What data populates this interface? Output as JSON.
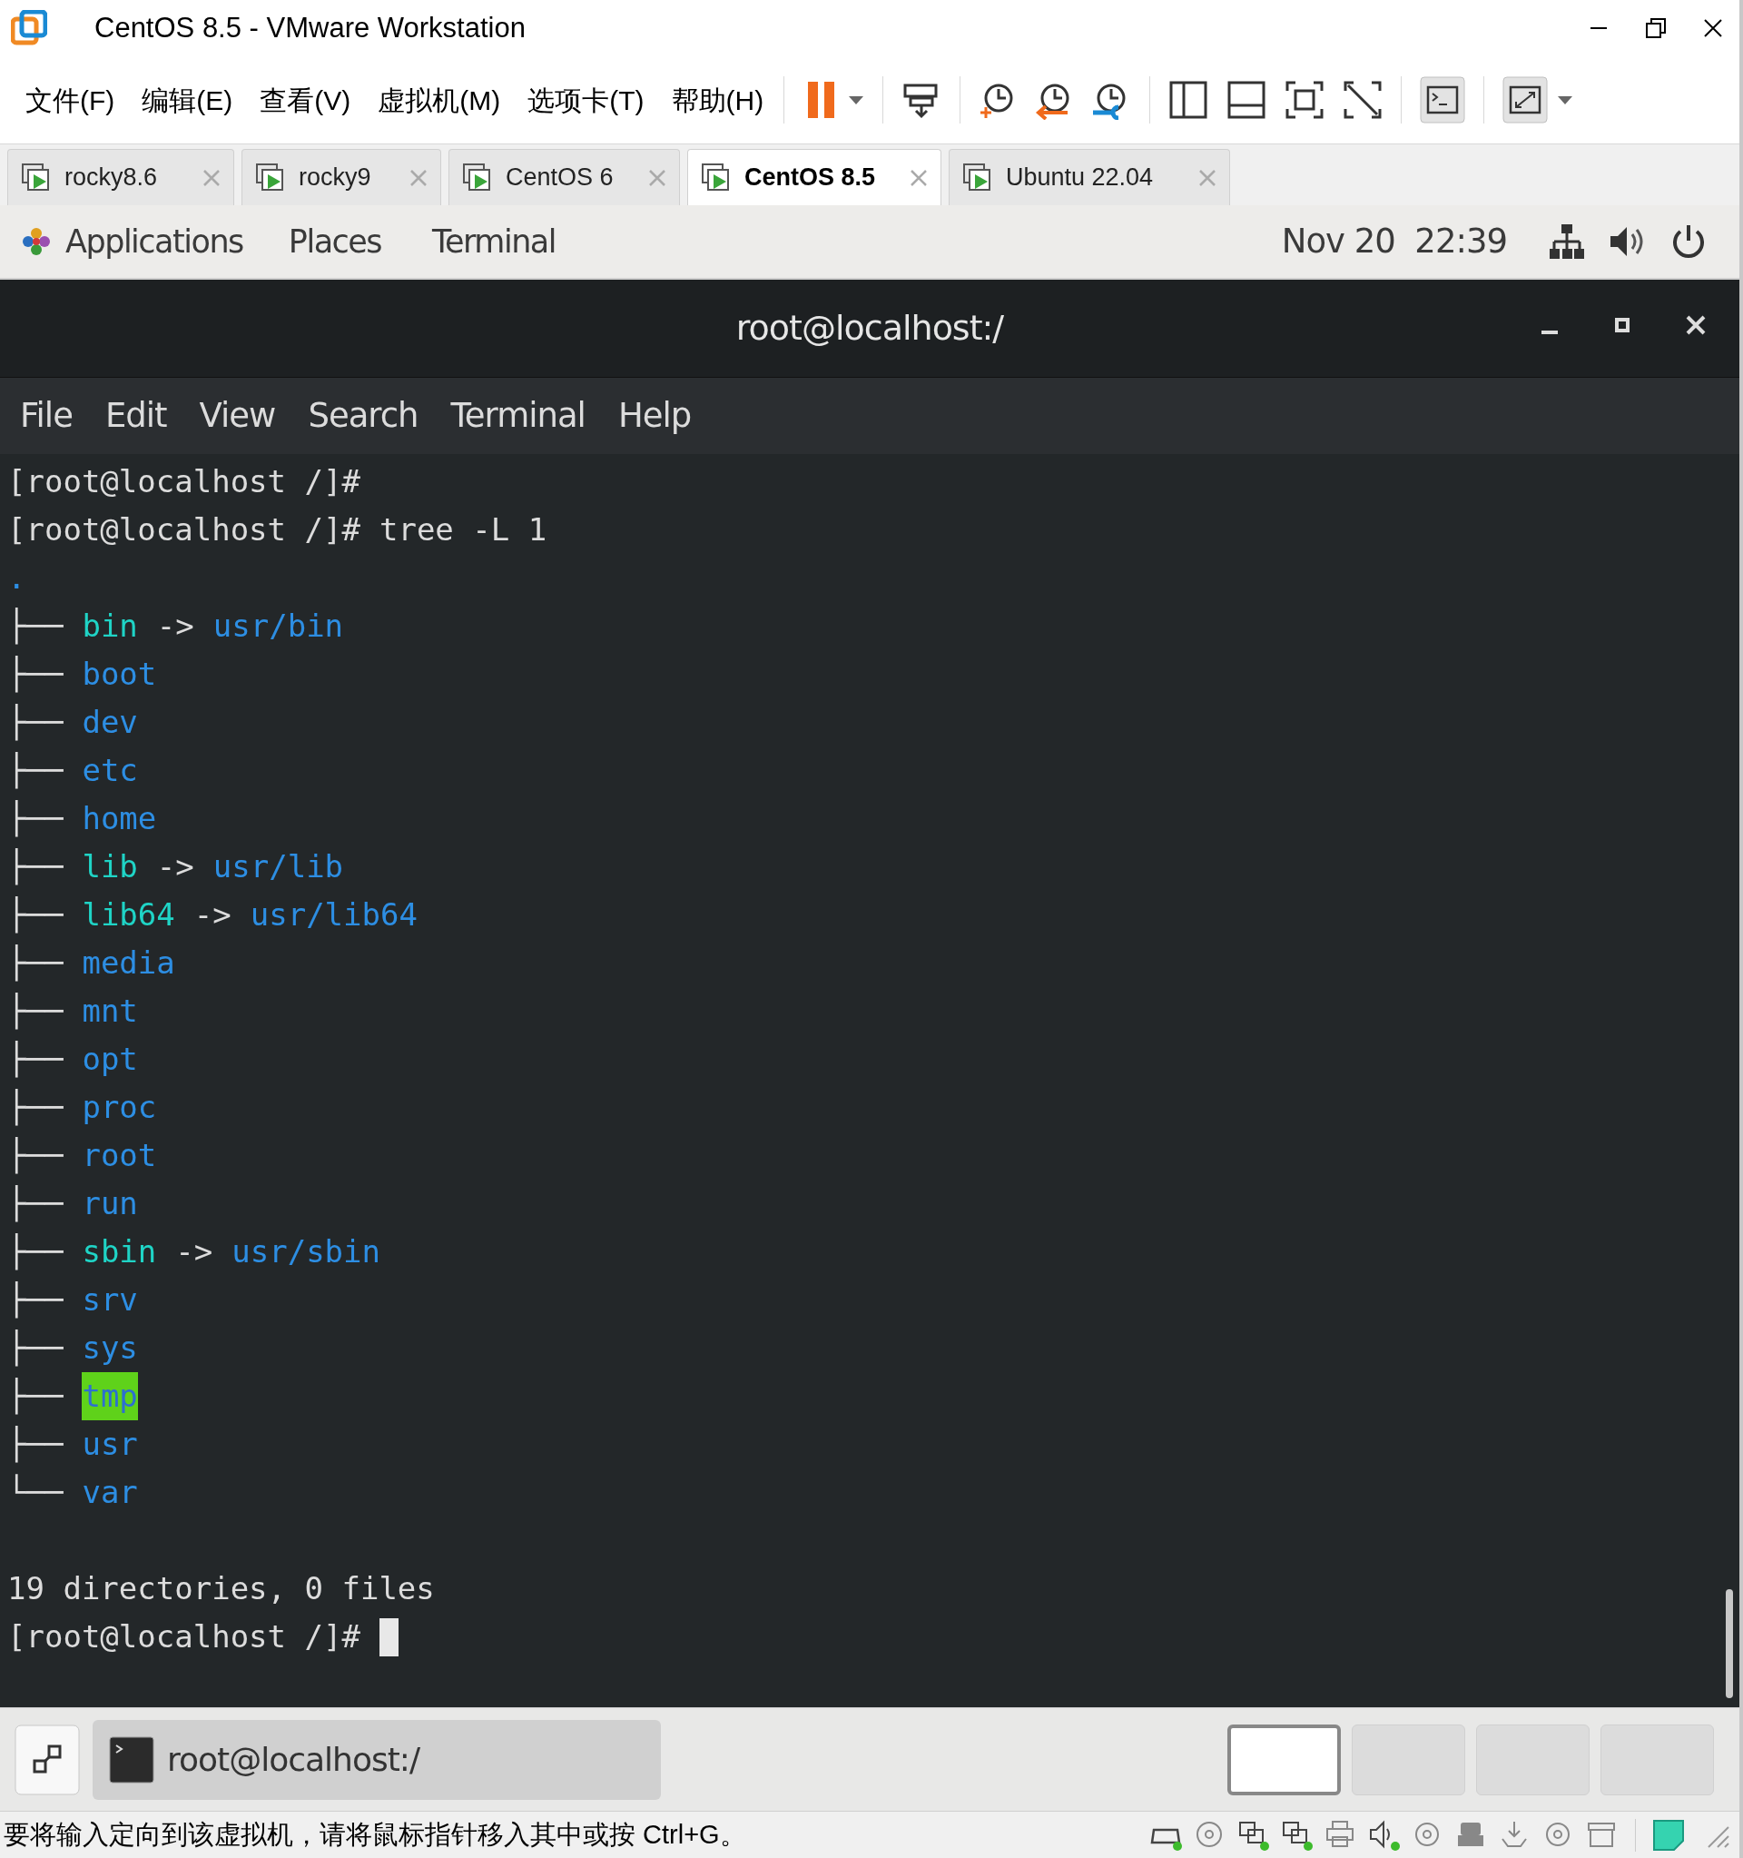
{
  "window": {
    "title": "CentOS 8.5 - VMware Workstation"
  },
  "menu": [
    "文件(F)",
    "编辑(E)",
    "查看(V)",
    "虚拟机(M)",
    "选项卡(T)",
    "帮助(H)"
  ],
  "tabs": [
    {
      "label": "rocky8.6",
      "selected": false
    },
    {
      "label": "rocky9",
      "selected": false
    },
    {
      "label": "CentOS 6",
      "selected": false
    },
    {
      "label": "CentOS 8.5",
      "selected": true
    },
    {
      "label": "Ubuntu 22.04",
      "selected": false
    }
  ],
  "gnome_bar": {
    "items": [
      "Applications",
      "Places",
      "Terminal"
    ],
    "clock": "Nov 20  22:39"
  },
  "terminal": {
    "title": "root@localhost:/",
    "menu": [
      "File",
      "Edit",
      "View",
      "Search",
      "Terminal",
      "Help"
    ],
    "lines": [
      {
        "kind": "prompt",
        "prompt": "[root@localhost /]#"
      },
      {
        "kind": "prompt",
        "prompt": "[root@localhost /]#",
        "command": "tree -L 1"
      },
      {
        "kind": "tree_root",
        "text": "."
      },
      {
        "kind": "link_entry",
        "branch": "├──",
        "name": "bin",
        "arrow": "->",
        "target": "usr/bin"
      },
      {
        "kind": "dir_entry",
        "branch": "├──",
        "name": "boot"
      },
      {
        "kind": "dir_entry",
        "branch": "├──",
        "name": "dev"
      },
      {
        "kind": "dir_entry",
        "branch": "├──",
        "name": "etc"
      },
      {
        "kind": "dir_entry",
        "branch": "├──",
        "name": "home"
      },
      {
        "kind": "link_entry",
        "branch": "├──",
        "name": "lib",
        "arrow": "->",
        "target": "usr/lib"
      },
      {
        "kind": "link_entry",
        "branch": "├──",
        "name": "lib64",
        "arrow": "->",
        "target": "usr/lib64"
      },
      {
        "kind": "dir_entry",
        "branch": "├──",
        "name": "media"
      },
      {
        "kind": "dir_entry",
        "branch": "├──",
        "name": "mnt"
      },
      {
        "kind": "dir_entry",
        "branch": "├──",
        "name": "opt"
      },
      {
        "kind": "dir_entry",
        "branch": "├──",
        "name": "proc"
      },
      {
        "kind": "dir_entry",
        "branch": "├──",
        "name": "root"
      },
      {
        "kind": "dir_entry",
        "branch": "├──",
        "name": "run"
      },
      {
        "kind": "link_entry",
        "branch": "├──",
        "name": "sbin",
        "arrow": "->",
        "target": "usr/sbin"
      },
      {
        "kind": "dir_entry",
        "branch": "├──",
        "name": "srv"
      },
      {
        "kind": "dir_entry",
        "branch": "├──",
        "name": "sys"
      },
      {
        "kind": "sticky_entry",
        "branch": "├──",
        "name": "tmp"
      },
      {
        "kind": "dir_entry",
        "branch": "├──",
        "name": "usr"
      },
      {
        "kind": "dir_entry",
        "branch": "└──",
        "name": "var"
      },
      {
        "kind": "blank"
      },
      {
        "kind": "output",
        "text": "19 directories, 0 files"
      },
      {
        "kind": "prompt",
        "prompt": "[root@localhost /]#",
        "cursor": true
      }
    ]
  },
  "taskbar": {
    "window_button": "root@localhost:/",
    "workspaces": [
      {
        "selected": true
      },
      {
        "selected": false
      },
      {
        "selected": false
      },
      {
        "selected": false
      }
    ]
  },
  "status_bar": {
    "message": "要将输入定向到该虚拟机，请将鼠标指针移入其中或按 Ctrl+G。"
  }
}
